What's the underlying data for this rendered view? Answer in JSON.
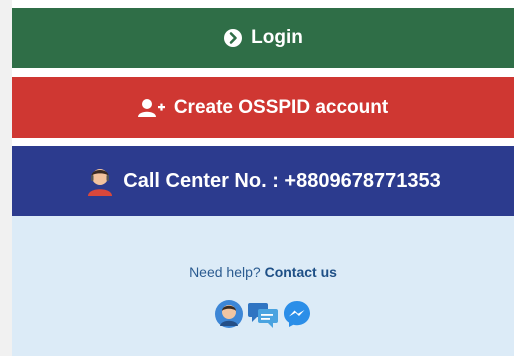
{
  "buttons": {
    "login": {
      "label": "Login",
      "icon": "chevron-right-circle-icon",
      "color": "#2f6e47"
    },
    "create": {
      "label": "Create OSSPID account",
      "icon": "add-user-icon",
      "color": "#cf3732"
    },
    "call": {
      "label": "Call Center No. : +8809678771353",
      "icon": "agent-avatar-icon",
      "color": "#2c3b8e"
    }
  },
  "help": {
    "prefix": "Need help?",
    "link": "Contact us",
    "icons": [
      "support-agent-icon",
      "chat-bubbles-icon",
      "messenger-icon"
    ],
    "background": "#dcebf7"
  }
}
